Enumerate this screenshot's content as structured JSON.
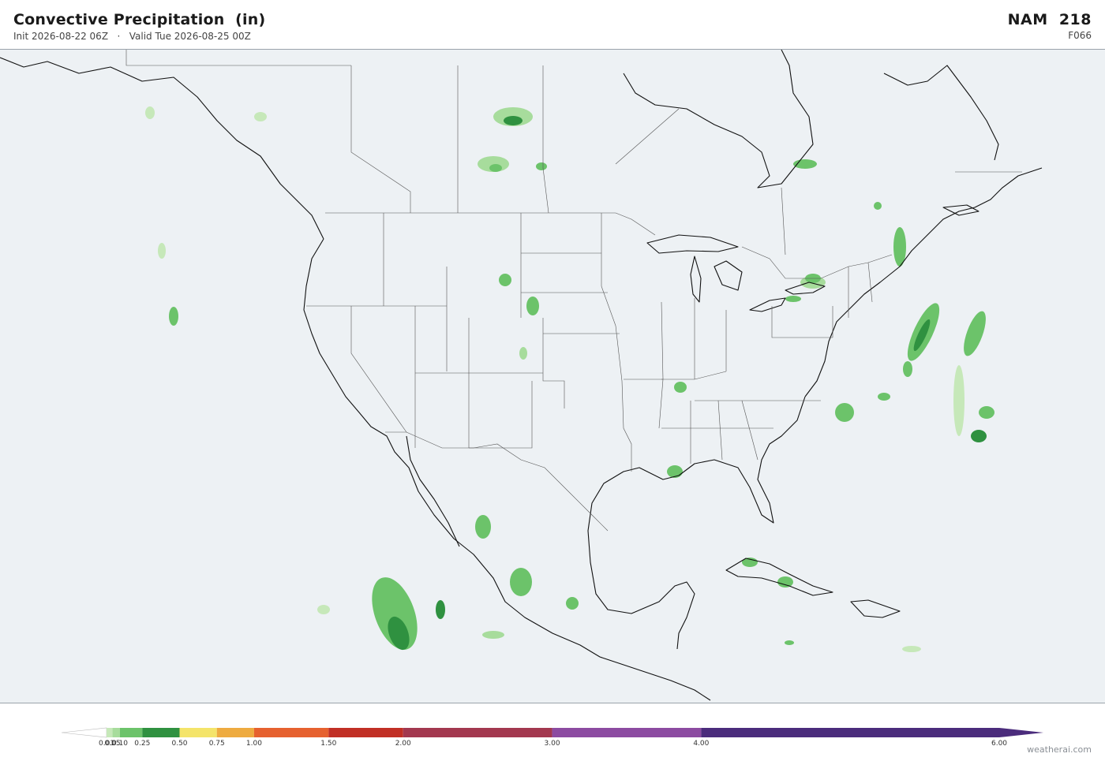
{
  "header": {
    "title": "Convective Precipitation  (in)",
    "subtitle": "Init 2026-08-22 06Z   ·   Valid Tue 2026-08-25 00Z",
    "model": "NAM  218",
    "forecast_hour": "F066"
  },
  "colors": {
    "ocean": "#edf1f4",
    "land": "#edf1f4",
    "coastline": "#111111",
    "borders": "#555555",
    "light_green": "#c6e8b9",
    "mid_green": "#6cc36a",
    "dark_green": "#2f9140"
  },
  "colorbar": {
    "unit": "in",
    "bins": [
      {
        "label": "0.01",
        "value": 0.01,
        "color": "#ffffff"
      },
      {
        "label": "0.05",
        "value": 0.05,
        "color": "#c6e8b9"
      },
      {
        "label": "0.10",
        "value": 0.1,
        "color": "#a7dc9c"
      },
      {
        "label": "0.25",
        "value": 0.25,
        "color": "#6cc36a"
      },
      {
        "label": "0.50",
        "value": 0.5,
        "color": "#2f9140"
      },
      {
        "label": "0.75",
        "value": 0.75,
        "color": "#f4e46a"
      },
      {
        "label": "1.00",
        "value": 1.0,
        "color": "#eeab40"
      },
      {
        "label": "1.50",
        "value": 1.5,
        "color": "#e6612f"
      },
      {
        "label": "2.00",
        "value": 2.0,
        "color": "#c12f25"
      },
      {
        "label": "3.00",
        "value": 3.0,
        "color": "#a3384f"
      },
      {
        "label": "4.00",
        "value": 4.0,
        "color": "#8c4ba1"
      },
      {
        "label": "6.00",
        "value": 6.0,
        "color": "#4b2c7c"
      }
    ],
    "tick_labels": [
      "0.01",
      "0.05",
      "0.10",
      "0.25",
      "0.50",
      "0.75",
      "1.00",
      "1.50",
      "2.00",
      "3.00",
      "4.00",
      "6.00"
    ]
  },
  "credit": "weatherai.com"
}
